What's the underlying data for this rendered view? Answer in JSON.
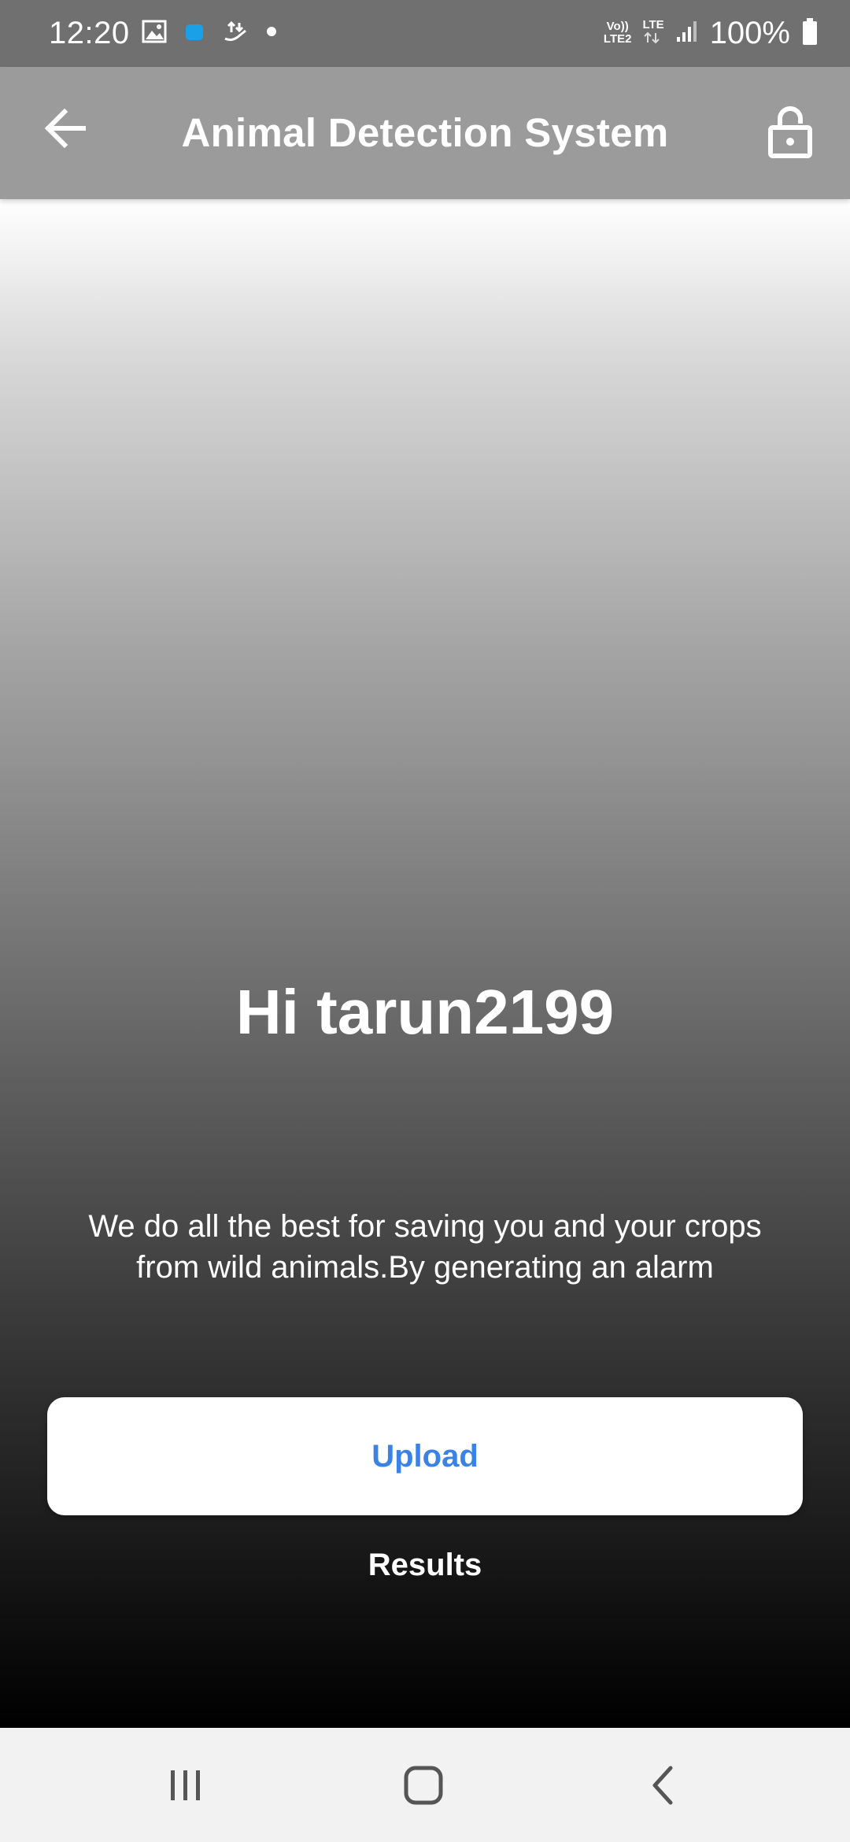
{
  "status_bar": {
    "time": "12:20",
    "battery": "100%",
    "volte_label_top": "Vo))",
    "volte_label_bottom": "LTE2",
    "lte_label": "LTE",
    "icons": [
      "gallery-icon",
      "app-notification-icon",
      "data-transfer-icon",
      "dot-icon",
      "signal-icon",
      "battery-icon"
    ]
  },
  "app_bar": {
    "title": "Animal Detection System",
    "back_icon": "back-arrow-icon",
    "lock_icon": "lock-icon"
  },
  "main": {
    "greeting": "Hi tarun2199",
    "description_line1": "We do all the best for saving you and your crops",
    "description_line2": "from wild animals.By generating an alarm",
    "upload_label": "Upload",
    "results_label": "Results"
  },
  "nav_bar": {
    "recents_icon": "recents-icon",
    "home_icon": "home-icon",
    "back_icon": "nav-back-icon"
  },
  "colors": {
    "status_bar": "#707070",
    "app_bar": "#9b9b9b",
    "accent": "#3b82e6",
    "nav_bar": "#f2f2f2"
  }
}
